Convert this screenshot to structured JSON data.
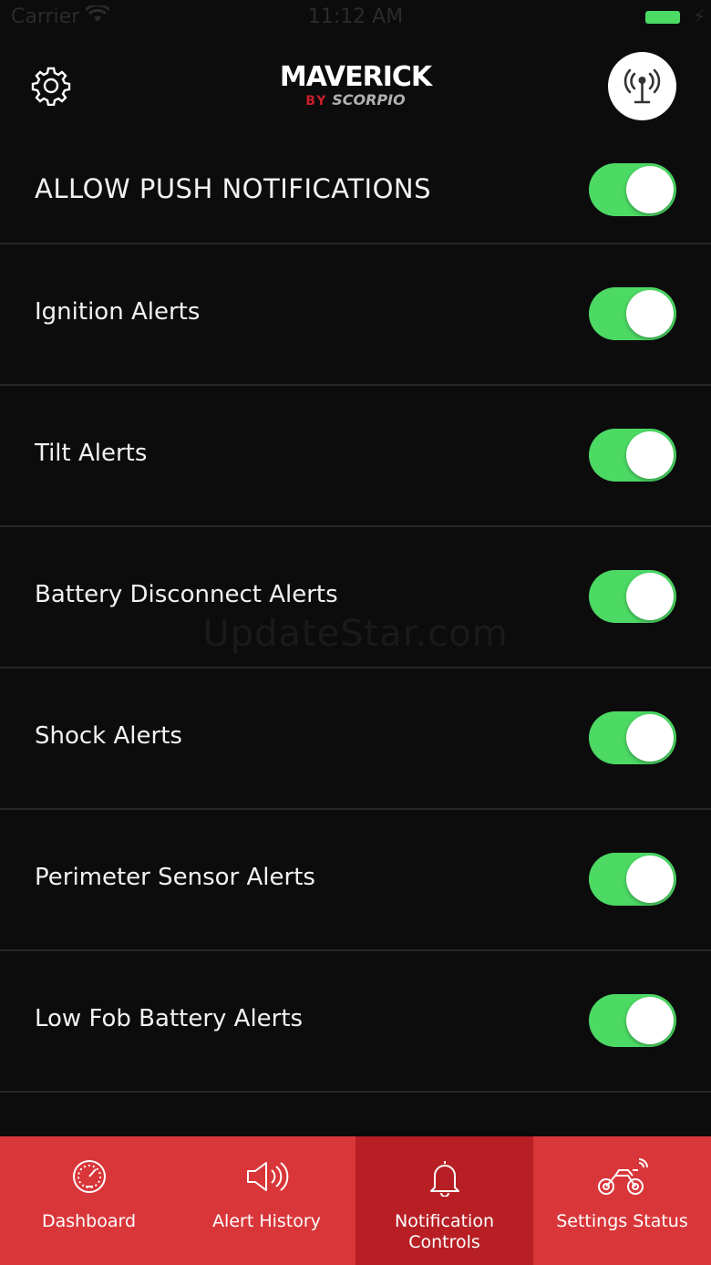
{
  "status_bar": {
    "carrier": "Carrier",
    "time": "11:12 AM"
  },
  "header": {
    "settings_icon": "gear-icon",
    "logo_main": "MAVERICK",
    "logo_by": "BY",
    "logo_brand": "SCORPIO",
    "remote_icon": "antenna-icon"
  },
  "push": {
    "label": "ALLOW PUSH NOTIFICATIONS",
    "enabled": true
  },
  "alerts": [
    {
      "label": "Ignition Alerts",
      "enabled": true
    },
    {
      "label": "Tilt Alerts",
      "enabled": true
    },
    {
      "label": "Battery Disconnect Alerts",
      "enabled": true
    },
    {
      "label": "Shock Alerts",
      "enabled": true
    },
    {
      "label": "Perimeter Sensor Alerts",
      "enabled": true
    },
    {
      "label": "Low Fob Battery Alerts",
      "enabled": true
    }
  ],
  "watermark": "UpdateStar.com",
  "tabs": [
    {
      "label": "Dashboard",
      "icon": "speedometer-icon",
      "active": false
    },
    {
      "label": "Alert History",
      "icon": "speaker-icon",
      "active": false
    },
    {
      "label": "Notification Controls",
      "icon": "bell-icon",
      "active": true
    },
    {
      "label": "Settings Status",
      "icon": "motorcycle-icon",
      "active": false
    }
  ],
  "colors": {
    "background": "#0c0c0d",
    "toggle_on": "#4cd964",
    "tabbar": "#d9363a",
    "tab_active": "#b71f24",
    "brand_red": "#c8202a"
  }
}
